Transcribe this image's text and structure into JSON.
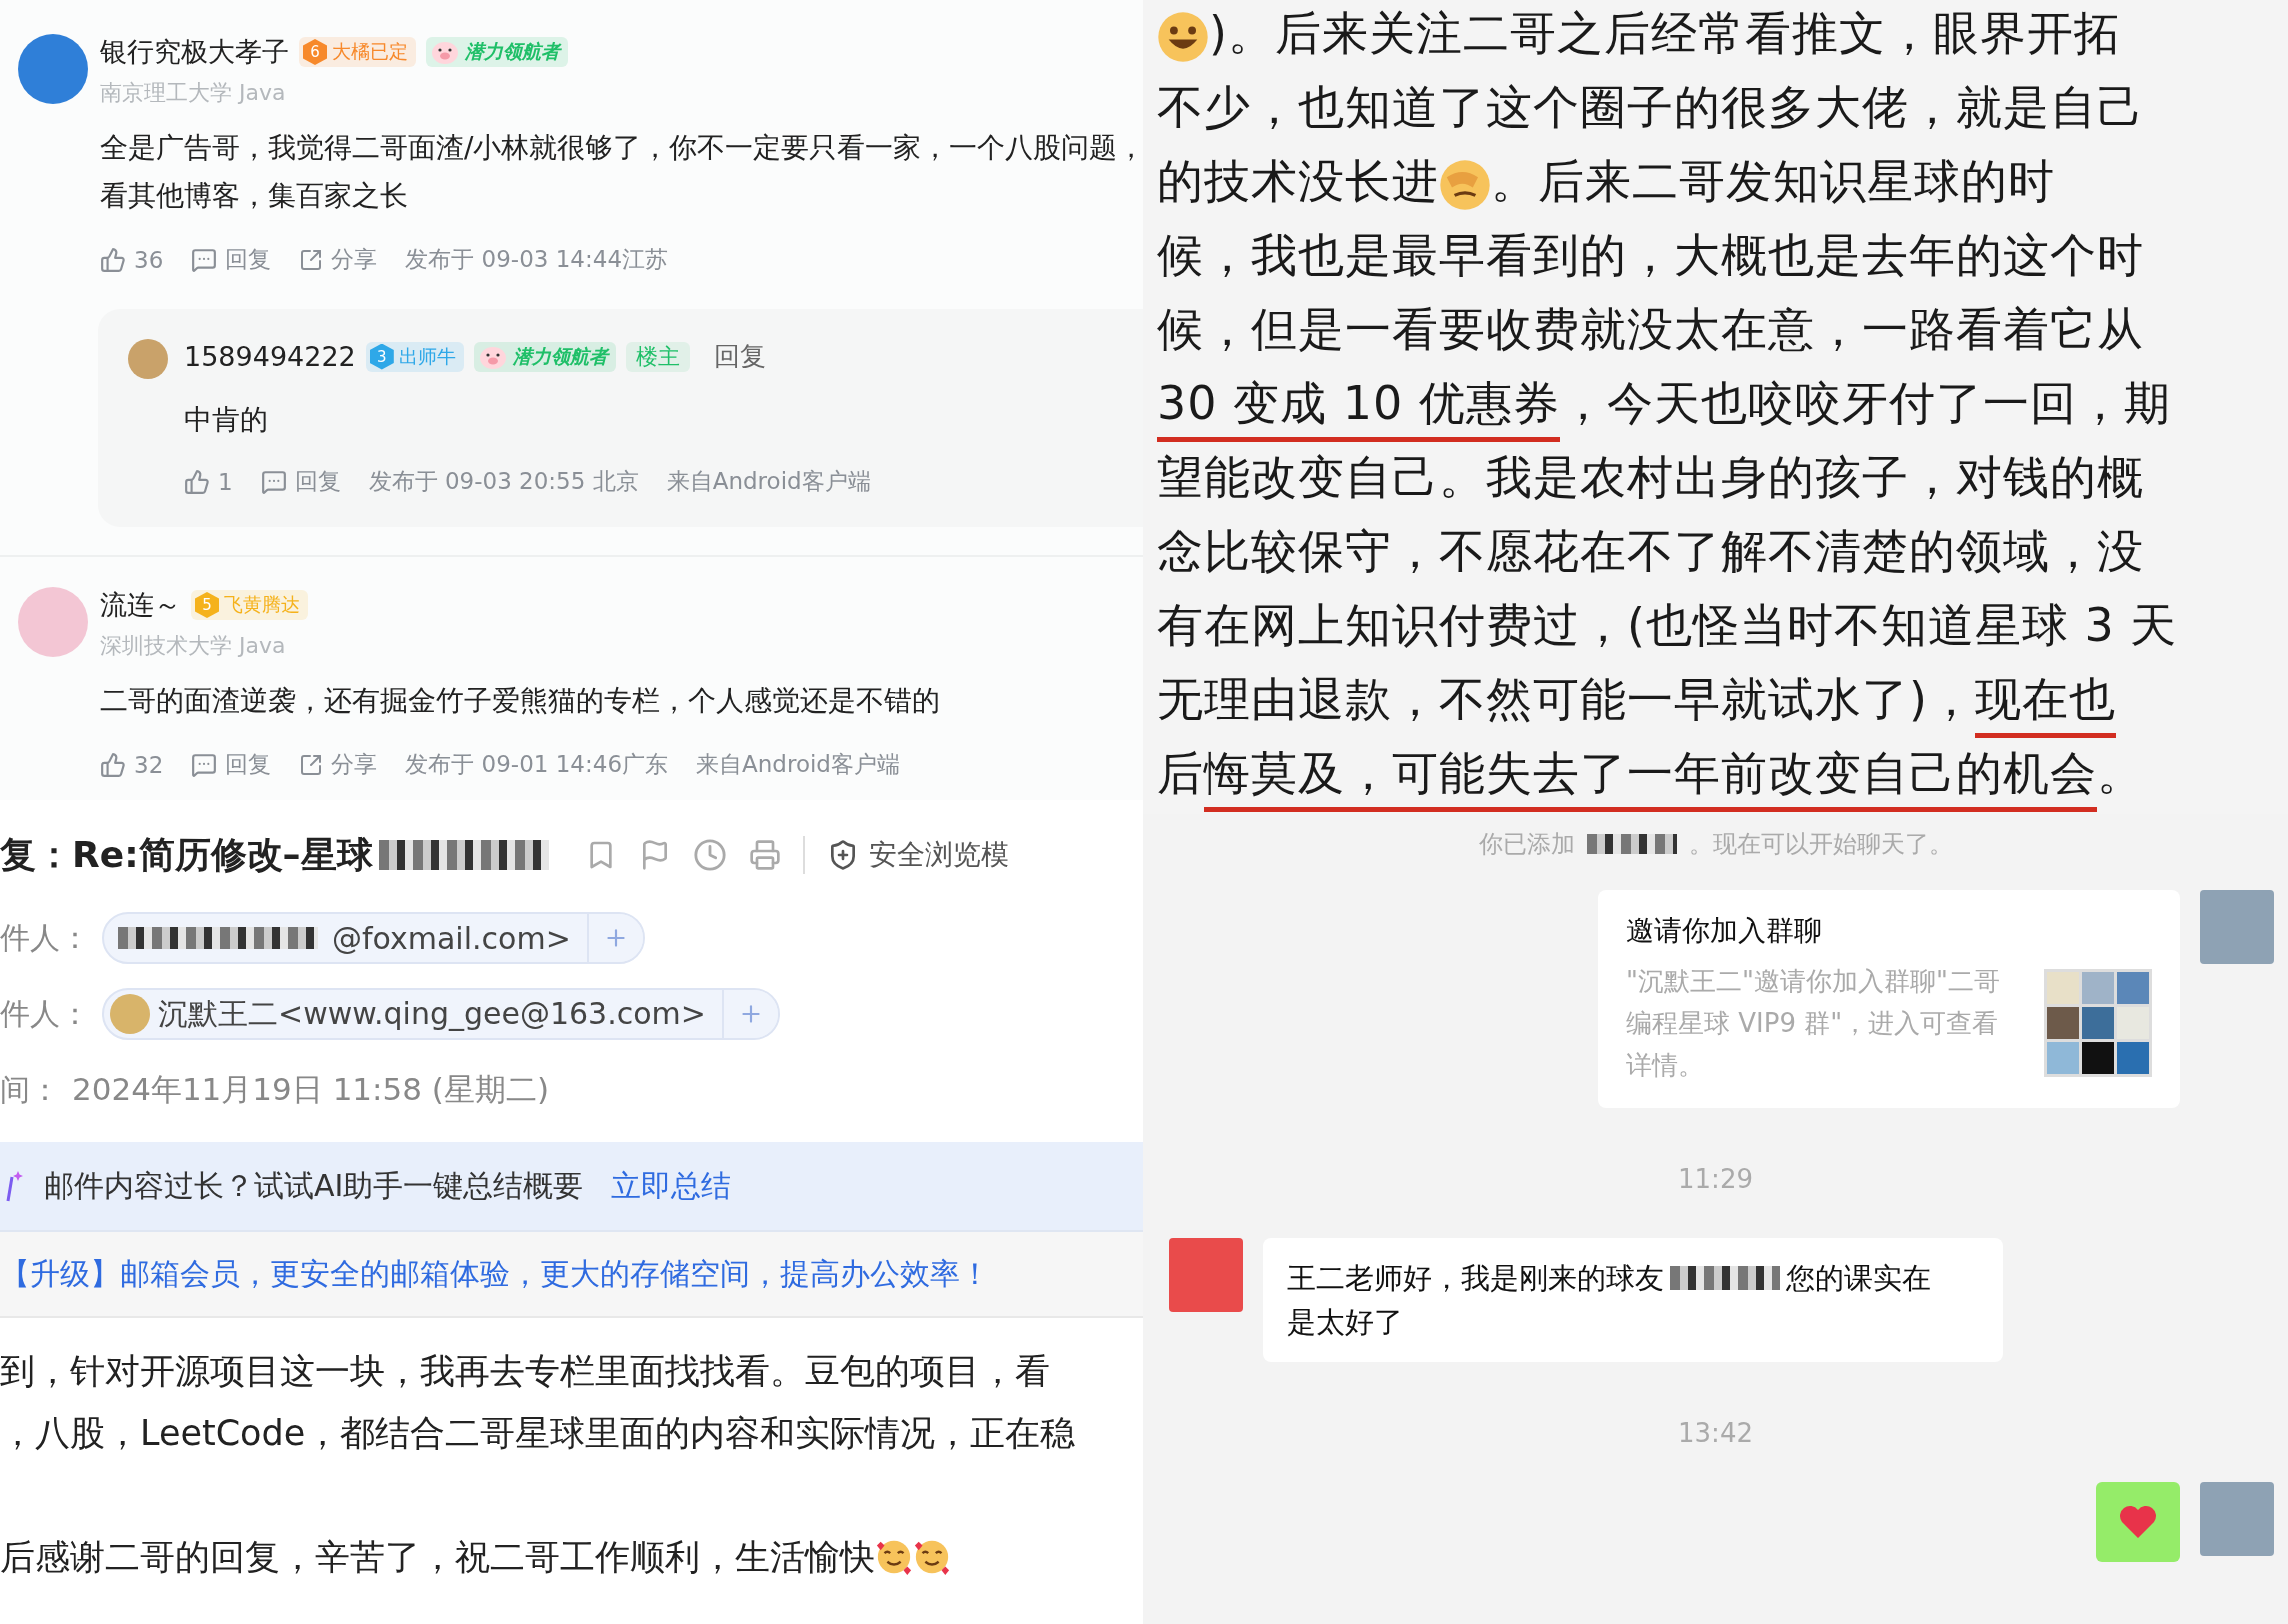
{
  "comments": [
    {
      "author": "银行究极大孝子",
      "badges": [
        {
          "kind": "level",
          "number": "6",
          "label": "大橘已定",
          "color": "#f7892b"
        },
        {
          "kind": "honor",
          "label": "潜力领航者",
          "color": "#1fbf68"
        }
      ],
      "school": "南京理工大学 Java",
      "text_lines": [
        "全是广告哥，我觉得二哥面渣/小林就很够了，你不一定要只看一家，一个八股问题，",
        "看其他博客，集百家之长"
      ],
      "likes": "36",
      "reply": "回复",
      "share": "分享",
      "posted": "发布于 09-03 14:44江苏",
      "replies": [
        {
          "author": "1589494222",
          "badges": [
            {
              "kind": "level",
              "number": "3",
              "label": "出师牛",
              "color": "#2ea8e8"
            },
            {
              "kind": "honor",
              "label": "潜力领航者",
              "color": "#1fbf68"
            },
            {
              "kind": "tag",
              "label": "楼主",
              "color": "#1fbf68"
            }
          ],
          "reply_link": "回复",
          "text_lines": [
            "中肯的"
          ],
          "likes": "1",
          "reply": "回复",
          "posted": "发布于 09-03 20:55 北京",
          "source": "来自Android客户端"
        }
      ]
    },
    {
      "author": "流连～",
      "badges": [
        {
          "kind": "level",
          "number": "5",
          "label": "飞黄腾达",
          "color": "#f5b21c"
        }
      ],
      "school": "深圳技术大学 Java",
      "text_lines": [
        "二哥的面渣逆袭，还有掘金竹子爱熊猫的专栏，个人感觉还是不错的"
      ],
      "likes": "32",
      "reply": "回复",
      "share": "分享",
      "posted": "发布于 09-01 14:46广东",
      "source": "来自Android客户端"
    }
  ],
  "email": {
    "subject": [
      {
        "kind": "text",
        "text": "复：Re:简历修改–星球"
      },
      {
        "kind": "redacted"
      }
    ],
    "safe_mode": "安全浏览模",
    "from_label": "件人：",
    "from_address": "@foxmail.com>",
    "to_label": "件人：",
    "to_address": "沉默王二<www.qing_gee@163.com>",
    "time_label": "间：",
    "time_value": "2024年11月19日 11:58 (星期二)",
    "ai_banner": {
      "text": "邮件内容过长？试试AI助手一键总结概要",
      "action": "立即总结"
    },
    "upgrade": "【升级】邮箱会员，更安全的邮箱体验，更大的存储空间，提高办公效率！",
    "body": [
      [
        [
          {
            "kind": "text",
            "text": "到，针对开源项目这一块，我再去专栏里面找找看。豆包的项目，看"
          }
        ],
        [
          {
            "kind": "text",
            "text": "，八股，LeetCode，都结合二哥星球里面的内容和实际情况，正在稳"
          }
        ]
      ],
      [
        [
          {
            "kind": "text",
            "text": "后感谢二哥的回复，辛苦了，祝二哥工作顺利，生活愉快"
          },
          {
            "kind": "blush"
          },
          {
            "kind": "blush"
          }
        ]
      ]
    ]
  },
  "chat": {
    "post_lines": [
      [
        {
          "kind": "grin"
        },
        {
          "kind": "text",
          "text": ")。后来关注二哥之后经常看推文，眼界开拓",
          "underlined": false
        }
      ],
      [
        {
          "kind": "text",
          "text": "不少，也知道了这个圈子的很多大佬，就是自己",
          "underlined": false
        }
      ],
      [
        {
          "kind": "text",
          "text": "的技术没长进",
          "underlined": false
        },
        {
          "kind": "facepalm"
        },
        {
          "kind": "text",
          "text": "。后来二哥发知识星球的时",
          "underlined": false
        }
      ],
      [
        {
          "kind": "text",
          "text": "候，我也是最早看到的，大概也是去年的这个时",
          "underlined": false
        }
      ],
      [
        {
          "kind": "text",
          "text": "候，但是一看要收费就没太在意，一路看着它从",
          "underlined": false
        }
      ],
      [
        {
          "kind": "text",
          "text": "30 变成 10 优惠券",
          "underlined": true
        },
        {
          "kind": "text",
          "text": "，今天也咬咬牙付了一回，期",
          "underlined": false
        }
      ],
      [
        {
          "kind": "text",
          "text": "望能改变自己。我是农村出身的孩子，对钱的概",
          "underlined": false
        }
      ],
      [
        {
          "kind": "text",
          "text": "念比较保守，不愿花在不了解不清楚的领域，没",
          "underlined": false
        }
      ],
      [
        {
          "kind": "text",
          "text": "有在网上知识付费过，(也怪当时不知道星球 3 天",
          "underlined": false
        }
      ],
      [
        {
          "kind": "text",
          "text": "无理由退款，不然可能一早就试水了)，",
          "underlined": false
        },
        {
          "kind": "text",
          "text": "现在也",
          "underlined": true
        }
      ],
      [
        {
          "kind": "text",
          "text": "后",
          "underlined": false
        },
        {
          "kind": "text",
          "text": "悔莫及，可能失去了一年前改变自己的机会",
          "underlined": true
        },
        {
          "kind": "text",
          "text": "。",
          "underlined": false
        }
      ]
    ],
    "system_note": [
      {
        "kind": "text",
        "text": "你已添加"
      },
      {
        "kind": "redacted"
      },
      {
        "kind": "text",
        "text": "。现在可以开始聊天了。"
      }
    ],
    "messages": [
      {
        "kind": "invite",
        "title": "邀请你加入群聊",
        "text": "\"沉默王二\"邀请你加入群聊\"二哥编程星球 VIP9 群\"，进入可查看详情。"
      },
      {
        "kind": "time",
        "text": "11:29"
      },
      {
        "kind": "message",
        "lines": [
          [
            {
              "kind": "text",
              "text": "王二老师好，我是刚来的球友"
            },
            {
              "kind": "redacted"
            },
            {
              "kind": "text",
              "text": "您的课实在"
            }
          ],
          [
            {
              "kind": "text",
              "text": "是太好了"
            }
          ]
        ]
      },
      {
        "kind": "time",
        "text": "13:42"
      },
      {
        "kind": "sticker"
      }
    ]
  }
}
